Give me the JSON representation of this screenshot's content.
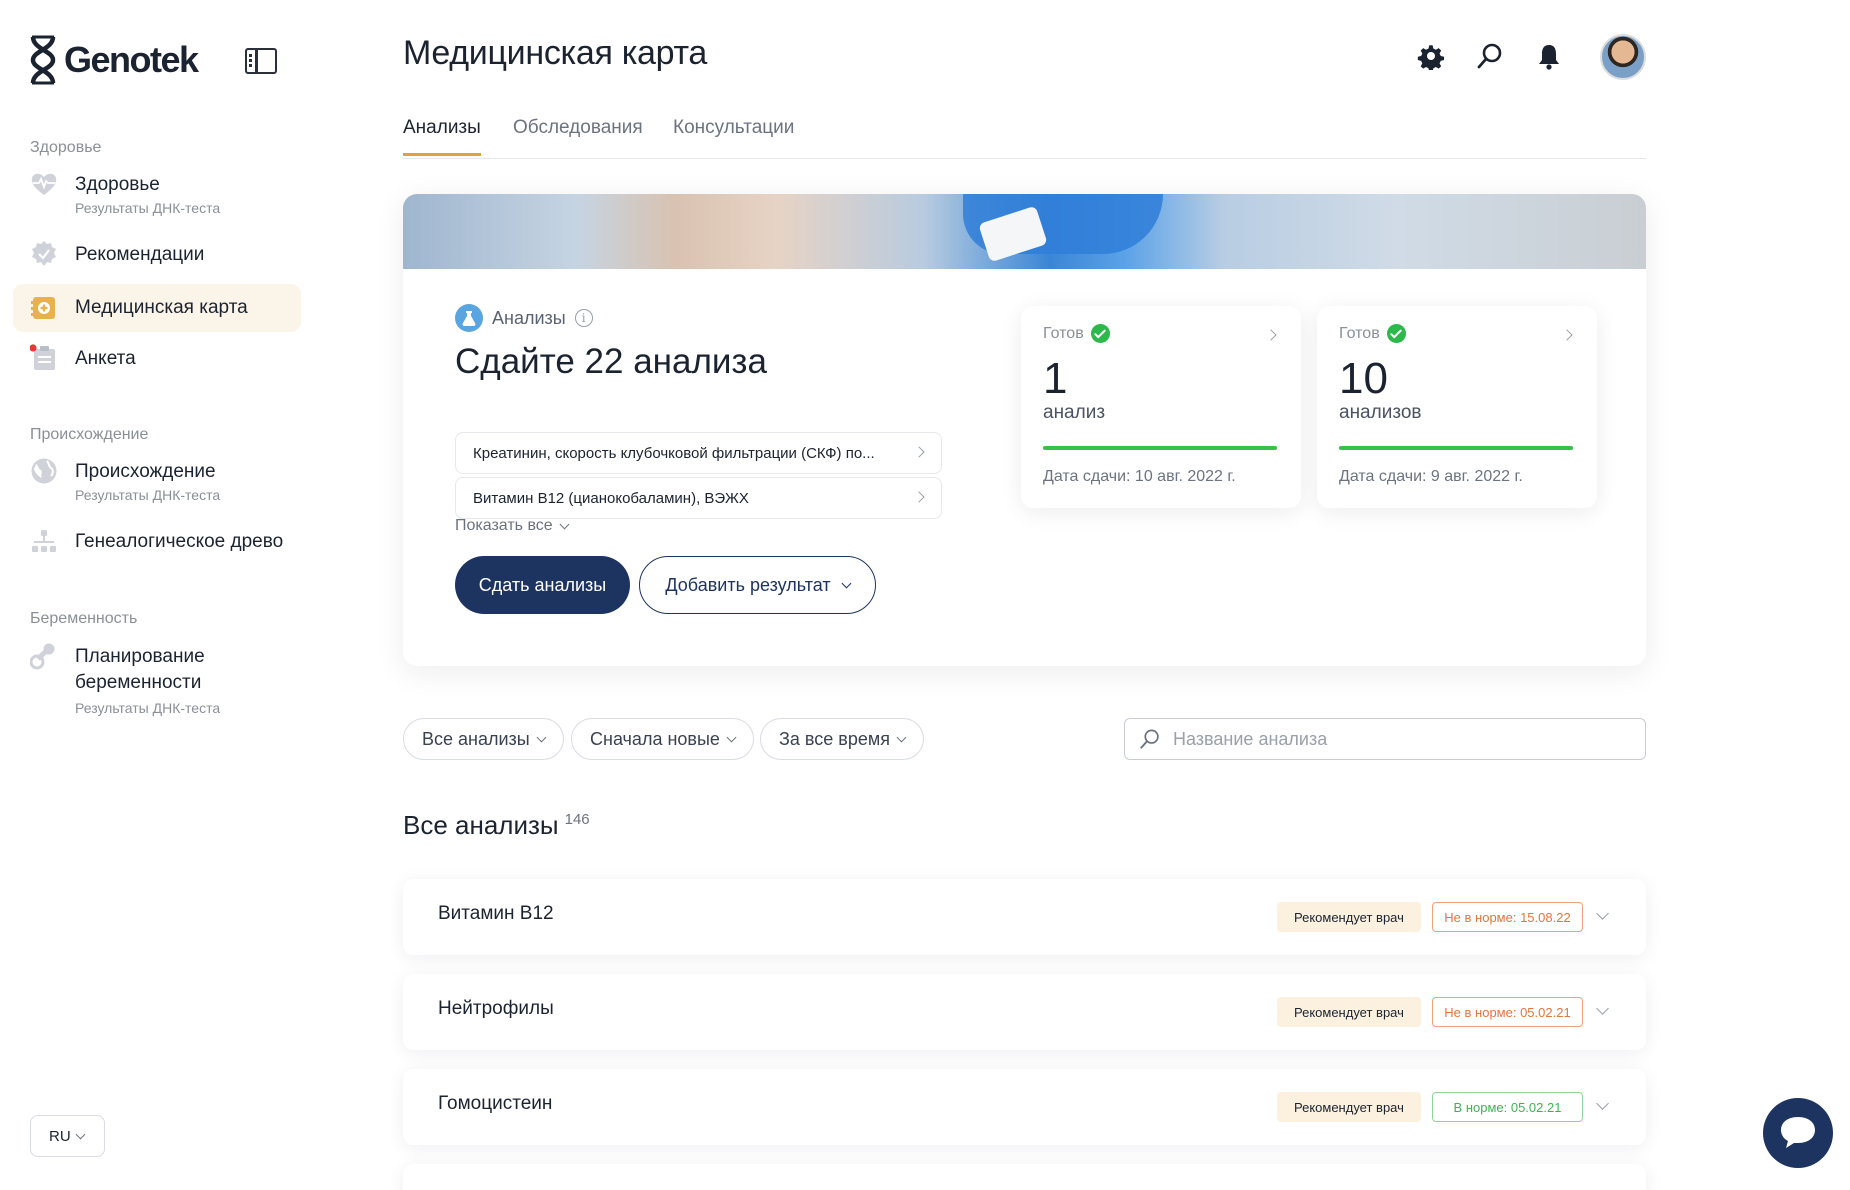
{
  "brand": {
    "logo_text": "Genotek"
  },
  "sidebar": {
    "sections": [
      {
        "title": "Здоровье"
      },
      {
        "title": "Происхождение"
      },
      {
        "title": "Беременность"
      }
    ],
    "items": [
      {
        "label": "Здоровье",
        "sub": "Результаты ДНК-теста"
      },
      {
        "label": "Рекомендации",
        "sub": ""
      },
      {
        "label": "Медицинская карта",
        "sub": ""
      },
      {
        "label": "Анкета",
        "sub": ""
      },
      {
        "label": "Происхождение",
        "sub": "Результаты ДНК-теста"
      },
      {
        "label": "Генеалогическое древо",
        "sub": ""
      },
      {
        "label": "Планирование беременности",
        "sub": "Результаты ДНК-теста"
      }
    ],
    "language": "RU"
  },
  "header": {
    "title": "Медицинская карта",
    "tabs": [
      {
        "label": "Анализы"
      },
      {
        "label": "Обследования"
      },
      {
        "label": "Консультации"
      }
    ]
  },
  "hero": {
    "tag": "Анализы",
    "heading": "Сдайте 22 анализа",
    "analyses": [
      "Креатинин, скорость клубочковой фильтрации (СКФ) по...",
      "Витамин B12 (цианокобаламин), ВЭЖХ"
    ],
    "show_all": "Показать все",
    "primary_button": "Сдать анализы",
    "secondary_button": "Добавить результат",
    "stats": [
      {
        "status": "Готов",
        "number": "1",
        "unit": "анализ",
        "date": "Дата сдачи: 10 авг. 2022 г.",
        "progress": 1.0
      },
      {
        "status": "Готов",
        "number": "10",
        "unit": "анализов",
        "date": "Дата сдачи: 9 авг. 2022 г.",
        "progress": 1.0
      }
    ]
  },
  "filters": {
    "type": "Все анализы",
    "sort": "Сначала новые",
    "period": "За все время",
    "search_placeholder": "Название анализа"
  },
  "list": {
    "title": "Все анализы",
    "count": "146",
    "rows": [
      {
        "name": "Витамин B12",
        "badge": "Рекомендует врач",
        "status": "Не в норме: 15.08.22",
        "status_type": "bad"
      },
      {
        "name": "Нейтрофилы",
        "badge": "Рекомендует врач",
        "status": "Не в норме: 05.02.21",
        "status_type": "bad"
      },
      {
        "name": "Гомоцистеин",
        "badge": "Рекомендует врач",
        "status": "В норме: 05.02.21",
        "status_type": "good"
      }
    ]
  },
  "colors": {
    "navy": "#1d3461",
    "accent": "#e0a23c",
    "ok_green": "#37c24a",
    "warn_orange": "#e2763c"
  }
}
